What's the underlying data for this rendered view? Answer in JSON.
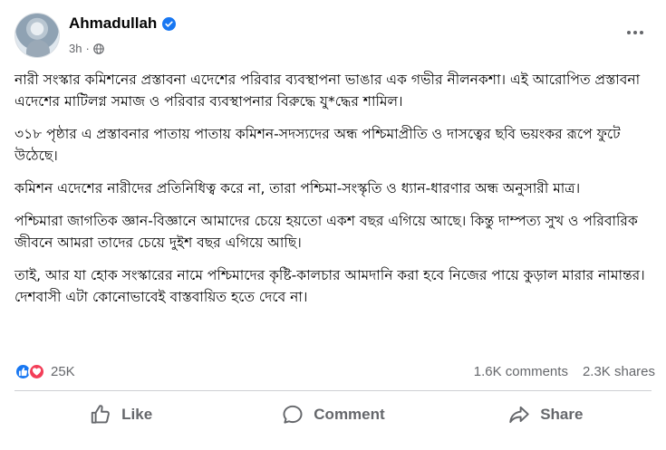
{
  "post": {
    "author": "Ahmadullah",
    "time": "3h",
    "privacy_icon": "globe-icon",
    "verified_icon": "verified-badge-icon",
    "more_icon": "more-options-icon",
    "paragraphs": [
      "নারী সংস্কার কমিশনের প্রস্তাবনা এদেশের পরিবার ব্যবস্থাপনা ভাঙার এক গভীর নীলনকশা। এই আরোপিত প্রস্তাবনা এদেশের মাটিলগ্ন সমাজ ও পরিবার ব্যবস্থাপনার বিরুদ্ধে যু*দ্ধের শামিল।",
      "৩১৮ পৃষ্ঠার এ প্রস্তাবনার পাতায় পাতায় কমিশন-সদস্যদের অন্ধ পশ্চিমাপ্রীতি ও দাসত্বের ছবি ভয়ংকর রূপে ফুটে উঠেছে।",
      "কমিশন এদেশের নারীদের প্রতিনিধিত্ব করে না, তারা পশ্চিমা-সংস্কৃতি ও ধ্যান-ধারণার অন্ধ অনুসারী মাত্র।",
      "পশ্চিমারা জাগতিক জ্ঞান-বিজ্ঞানে আমাদের চেয়ে হয়তো একশ বছর এগিয়ে আছে। কিন্তু দাম্পত্য সুখ ও পরিবারিক জীবনে আমরা তাদের চেয়ে দুইশ বছর এগিয়ে আছি।",
      "তাই, আর যা হোক সংস্কারের নামে পশ্চিমাদের কৃষ্টি-কালচার আমদানি করা হবে নিজের পায়ে কুড়াল মারার নামান্তর। দেশবাসী এটা কোনোভাবেই বাস্তবায়িত হতে দেবে না।"
    ]
  },
  "stats": {
    "reactions_count": "25K",
    "comments": "1.6K comments",
    "shares": "2.3K shares"
  },
  "actions": {
    "like": "Like",
    "comment": "Comment",
    "share": "Share"
  },
  "colors": {
    "accent": "#1877f2",
    "love": "#f33e58",
    "secondary_text": "#65676b"
  }
}
